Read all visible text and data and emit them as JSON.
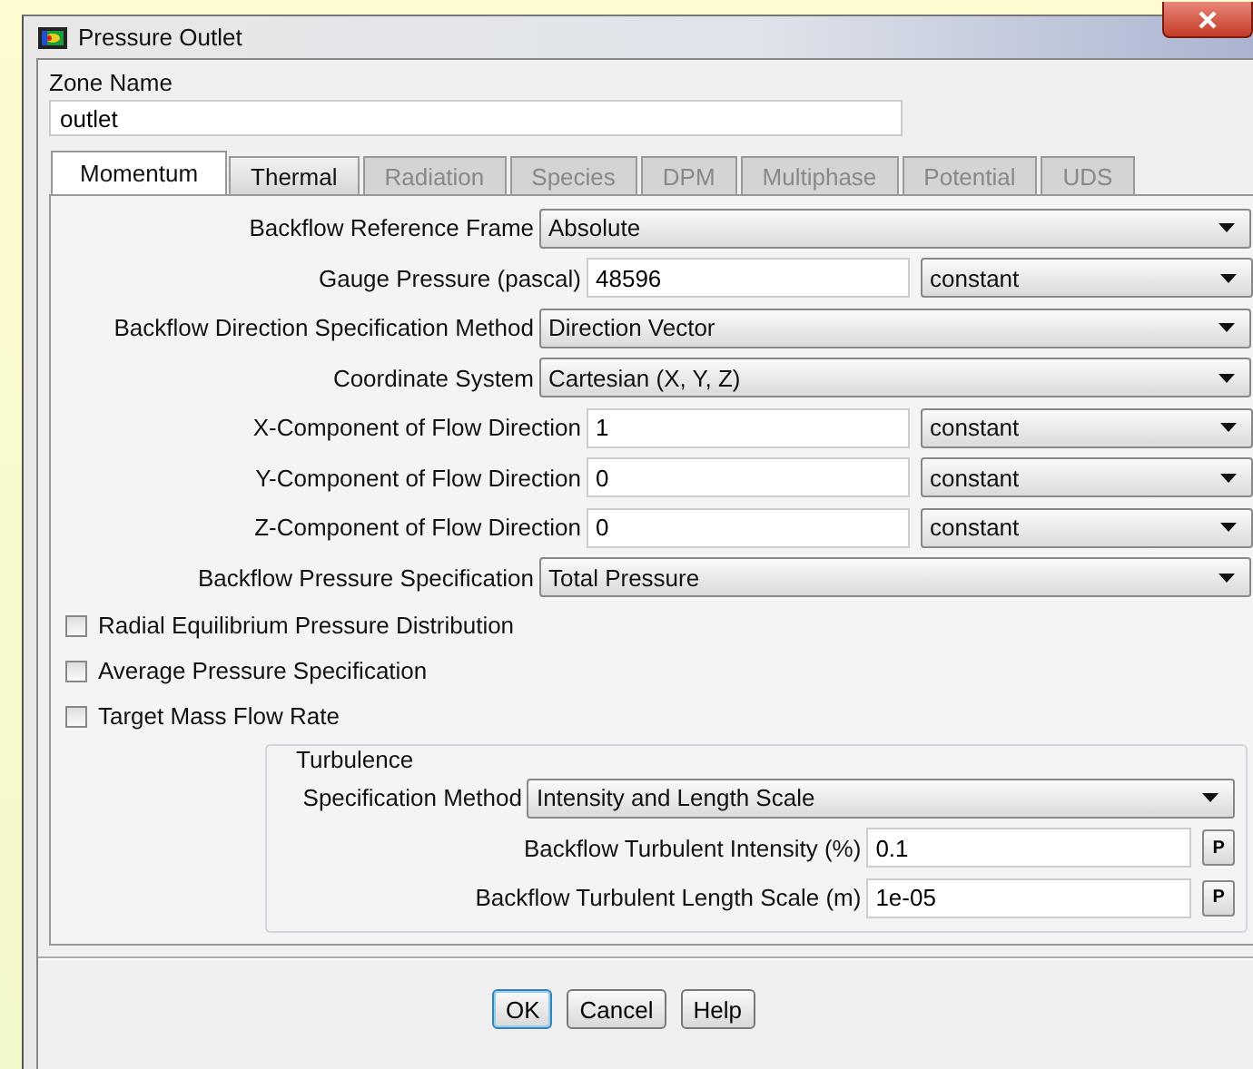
{
  "window": {
    "title": "Pressure Outlet"
  },
  "zone_name": {
    "label": "Zone Name",
    "value": "outlet"
  },
  "tabs": [
    {
      "label": "Momentum",
      "selected": true,
      "disabled": false
    },
    {
      "label": "Thermal",
      "selected": false,
      "disabled": false
    },
    {
      "label": "Radiation",
      "selected": false,
      "disabled": true
    },
    {
      "label": "Species",
      "selected": false,
      "disabled": true
    },
    {
      "label": "DPM",
      "selected": false,
      "disabled": true
    },
    {
      "label": "Multiphase",
      "selected": false,
      "disabled": true
    },
    {
      "label": "Potential",
      "selected": false,
      "disabled": true
    },
    {
      "label": "UDS",
      "selected": false,
      "disabled": true
    }
  ],
  "fields": [
    {
      "kind": "dropdown",
      "label": "Backflow Reference Frame",
      "value": "Absolute"
    },
    {
      "kind": "value",
      "label": "Gauge Pressure (pascal)",
      "value": "48596",
      "profile": "constant"
    },
    {
      "kind": "dropdown",
      "label": "Backflow Direction Specification Method",
      "value": "Direction Vector"
    },
    {
      "kind": "dropdown",
      "label": "Coordinate System",
      "value": "Cartesian (X, Y, Z)"
    },
    {
      "kind": "value",
      "label": "X-Component of Flow Direction",
      "value": "1",
      "profile": "constant"
    },
    {
      "kind": "value",
      "label": "Y-Component of Flow Direction",
      "value": "0",
      "profile": "constant"
    },
    {
      "kind": "value",
      "label": "Z-Component of Flow Direction",
      "value": "0",
      "profile": "constant"
    },
    {
      "kind": "dropdown",
      "label": "Backflow Pressure Specification",
      "value": "Total Pressure"
    }
  ],
  "options": [
    {
      "label": "Radial Equilibrium Pressure Distribution",
      "checked": false
    },
    {
      "label": "Average Pressure Specification",
      "checked": false
    },
    {
      "label": "Target Mass Flow Rate",
      "checked": false
    }
  ],
  "turbulence": {
    "title": "Turbulence",
    "method": {
      "label": "Specification Method",
      "value": "Intensity and Length Scale"
    },
    "parameters": [
      {
        "label": "Backflow Turbulent Intensity (%)",
        "value": "0.1",
        "button": "P"
      },
      {
        "label": "Backflow Turbulent Length Scale (m)",
        "value": "1e-05",
        "button": "P"
      }
    ]
  },
  "buttons": [
    {
      "label": "OK",
      "default": true
    },
    {
      "label": "Cancel",
      "default": false
    },
    {
      "label": "Help",
      "default": false
    }
  ]
}
